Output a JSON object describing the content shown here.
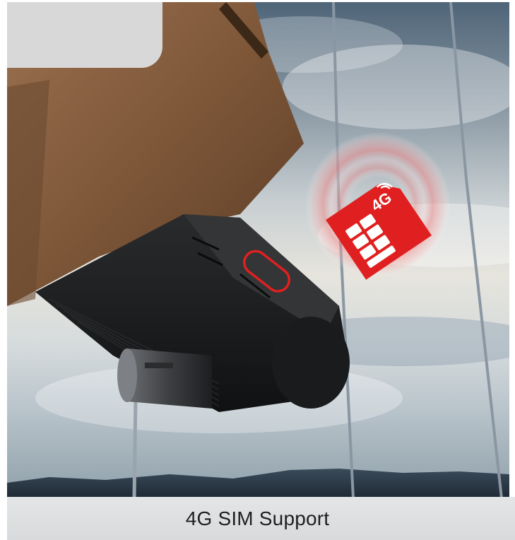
{
  "caption": {
    "title": "4G SIM Support"
  },
  "sim_card": {
    "label": "4G",
    "icon": "sim-card-icon",
    "accent": "#e02020"
  },
  "highlight": {
    "color": "#e02020",
    "target": "sim-card-slot"
  }
}
